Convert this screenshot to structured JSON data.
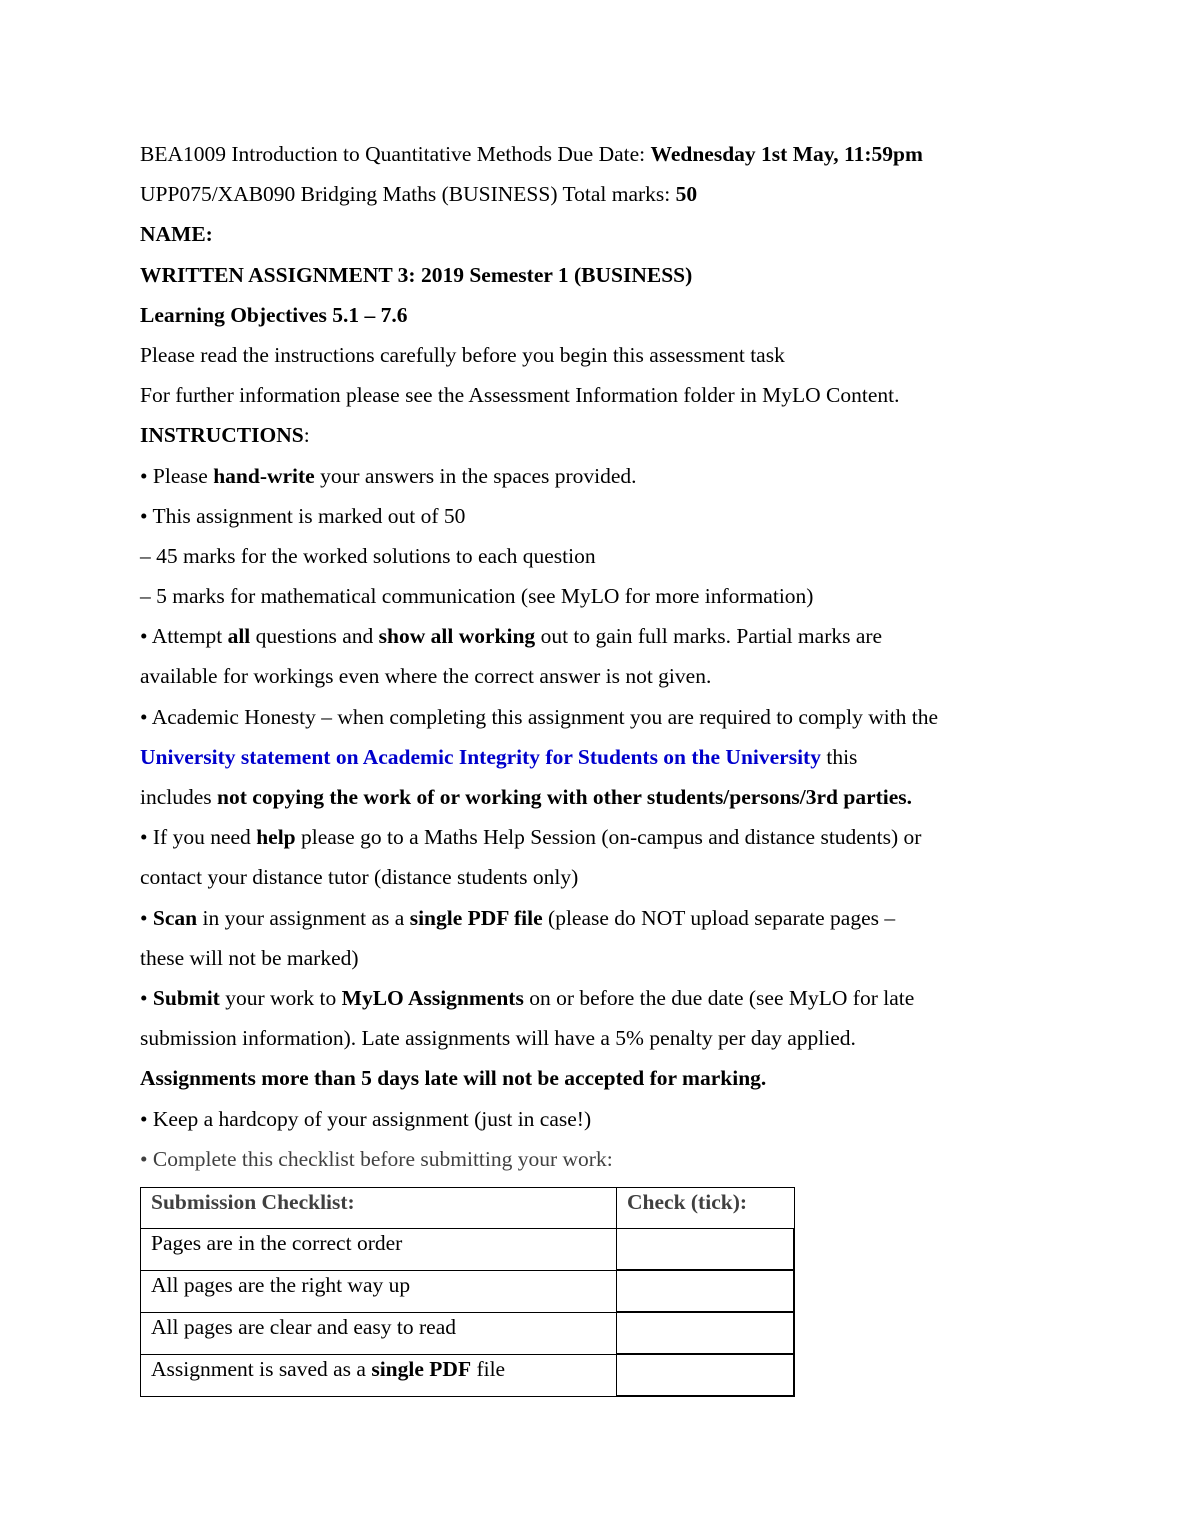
{
  "header": {
    "line1_text": "BEA1009 Introduction to Quantitative Methods Due Date: ",
    "due_date": "Wednesday 1st May, 11:59pm",
    "line2_text": "UPP075/XAB090 Bridging Maths (BUSINESS) Total marks: ",
    "total_marks": "50",
    "name_label": "NAME:",
    "assignment_title": "WRITTEN ASSIGNMENT 3: 2019 Semester 1 (BUSINESS)",
    "learning_objectives": "Learning Objectives 5.1 – 7.6",
    "read_instructions": "Please read the instructions carefully before you begin this assessment task",
    "further_info": "For further information please see the Assessment Information folder in MyLO Content."
  },
  "instructions": {
    "heading": "INSTRUCTIONS",
    "heading_colon": ":",
    "b1_pre": "• Please ",
    "b1_bold": "hand-write",
    "b1_post": " your answers in the spaces provided.",
    "b2": "• This assignment is marked out of 50",
    "b2_sub1": "– 45 marks for the worked solutions to each question",
    "b2_sub2": "– 5 marks for mathematical communication (see MyLO for more information)",
    "b3_pre": "• Attempt ",
    "b3_bold1": "all",
    "b3_mid": " questions and ",
    "b3_bold2": "show all working",
    "b3_post": " out to gain full marks. Partial marks are",
    "b3_line2": "available for workings even where the correct answer is not given.",
    "b4_line1": "• Academic Honesty – when completing this assignment you are required to comply with the",
    "b4_link": "University statement on Academic Integrity for Students on the University",
    "b4_after_link": " this",
    "b4_pre3": "includes ",
    "b4_bold3": "not copying the work of or working with other students/persons/3rd parties.",
    "b5_pre": "• If you need ",
    "b5_bold": "help",
    "b5_post": " please go to a Maths Help Session (on-campus and distance students) or",
    "b5_line2": "contact your distance tutor (distance students only)",
    "b6_pre": "• ",
    "b6_bold1": "Scan",
    "b6_mid": " in your assignment as a ",
    "b6_bold2": "single PDF file",
    "b6_post": " (please do NOT upload separate pages –",
    "b6_line2": "these will not be marked)",
    "b7_pre": "• ",
    "b7_bold1": "Submit",
    "b7_mid": " your work to ",
    "b7_bold2": "MyLO Assignments",
    "b7_post": " on or before the due date (see MyLO for late",
    "b7_line2": "submission information). Late assignments will have a 5% penalty per day applied.",
    "b7_bold_line3": "Assignments more than 5 days late will not be accepted for marking.",
    "b8": "• Keep a hardcopy of your assignment (just in case!)",
    "b9": "• Complete this checklist before submitting your work:"
  },
  "checklist": {
    "header_item": "Submission Checklist:",
    "header_check": "Check (tick):",
    "rows": [
      {
        "pre": "Pages are in the correct order",
        "bold": "",
        "post": ""
      },
      {
        "pre": "All pages are the right way up",
        "bold": "",
        "post": ""
      },
      {
        "pre": "All pages are clear and easy to read",
        "bold": "",
        "post": ""
      },
      {
        "pre": "Assignment is saved as a ",
        "bold": "single PDF",
        "post": " file"
      }
    ]
  },
  "colors": {
    "link": "#0000cc",
    "muted_text": "#404040"
  }
}
